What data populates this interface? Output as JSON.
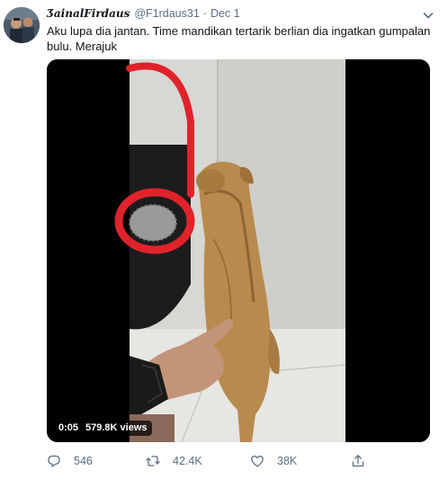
{
  "tweet": {
    "display_name": "ƷainalFirdaus",
    "handle": "@F1rdaus31",
    "separator": "·",
    "date": "Dec 1",
    "text": "Aku lupa dia jantan. Time mandikan tertarik berlian dia ingatkan gumpalan bulu. Merajuk"
  },
  "media": {
    "duration": "0:05",
    "views": "579.8K views"
  },
  "actions": {
    "replies": "546",
    "retweets": "42.4K",
    "likes": "38K"
  },
  "colors": {
    "text": "#0f1419",
    "secondary": "#5b7083",
    "mop_handle": "#e0232b"
  },
  "icons": [
    "chevron-down-icon",
    "reply-icon",
    "retweet-icon",
    "like-icon",
    "share-icon"
  ]
}
